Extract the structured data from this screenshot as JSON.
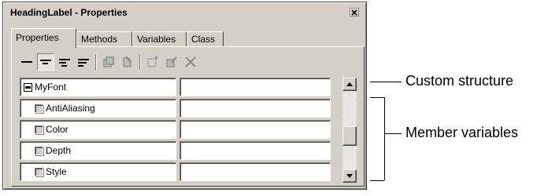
{
  "window": {
    "title": "HeadingLabel - Properties",
    "close_icon": "close-icon"
  },
  "tabs": [
    {
      "label": "Properties",
      "active": true
    },
    {
      "label": "Methods",
      "active": false
    },
    {
      "label": "Variables",
      "active": false
    },
    {
      "label": "Class",
      "active": false
    }
  ],
  "toolbar": {
    "buttons": [
      {
        "icon": "no-indent-icon",
        "pressed": false
      },
      {
        "icon": "indent-one-icon",
        "pressed": true
      },
      {
        "icon": "indent-two-icon",
        "pressed": false
      },
      {
        "icon": "indent-three-icon",
        "pressed": false
      },
      {
        "icon": "cut-icon",
        "pressed": false,
        "disabled": true
      },
      {
        "icon": "paste-icon",
        "pressed": false,
        "disabled": true
      },
      {
        "icon": "new-property-icon",
        "pressed": false,
        "disabled": true
      },
      {
        "icon": "edit-property-icon",
        "pressed": false,
        "disabled": true
      },
      {
        "icon": "delete-icon",
        "pressed": false,
        "disabled": true
      }
    ]
  },
  "properties": [
    {
      "name": "MyFont",
      "value": "",
      "kind": "structure",
      "expanded": true
    },
    {
      "name": "AntiAliasing",
      "value": "",
      "kind": "member"
    },
    {
      "name": "Color",
      "value": "",
      "kind": "member"
    },
    {
      "name": "Depth",
      "value": "",
      "kind": "member"
    },
    {
      "name": "Style",
      "value": "",
      "kind": "member"
    }
  ],
  "scrollbar": {
    "position": 0.6
  },
  "annotations": {
    "custom_structure": "Custom structure",
    "member_variables": "Member variables"
  },
  "colors": {
    "face": "#d4d0c8",
    "highlight": "#ffffff",
    "shadow": "#808080",
    "dark_shadow": "#404040",
    "disabled_icon": "#8a8a8a"
  }
}
